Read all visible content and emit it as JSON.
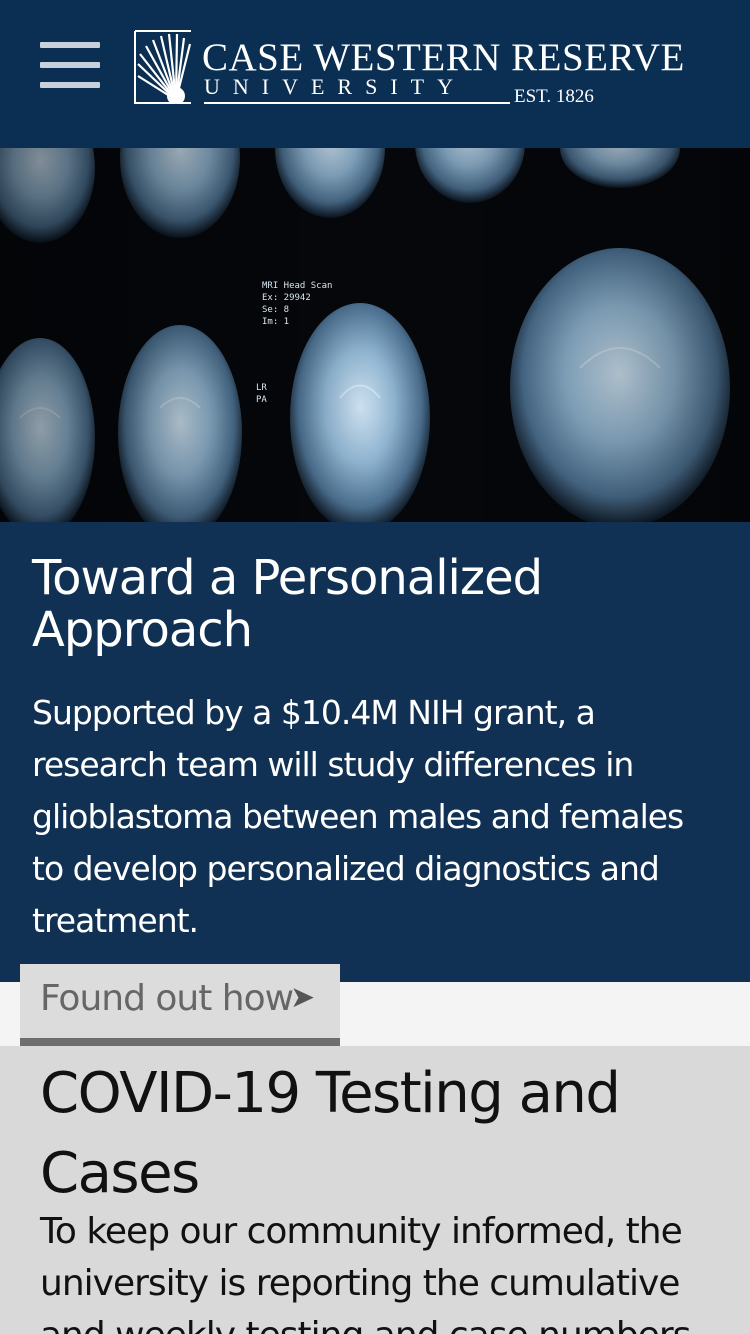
{
  "header": {
    "menu_icon": "hamburger-menu-icon",
    "logo": {
      "line1": "CASE WESTERN RESERVE",
      "line2": "UNIVERSITY",
      "est": "EST. 1826"
    },
    "colors": {
      "background": "#0a2f52"
    }
  },
  "hero": {
    "scan_labels": [
      "MRI Head Scan",
      "Ex: 29942",
      "Se: 8",
      "Im: 1",
      "LR",
      "PA"
    ]
  },
  "feature": {
    "title": "Toward a Personalized Approach",
    "body": "Supported by a $10.4M NIH grant, a research team will study differences in glioblastoma between males and females to develop personalized diagnostics and treatment.",
    "cta_label": "Found out how",
    "cta_icon": "arrow-right-icon",
    "colors": {
      "background": "#103153",
      "cta_background": "#dcdcdc"
    }
  },
  "covid": {
    "title": "COVID-19 Testing and Cases",
    "body": "To keep our community informed, the university is reporting the cumulative and weekly testing and case numbers"
  }
}
